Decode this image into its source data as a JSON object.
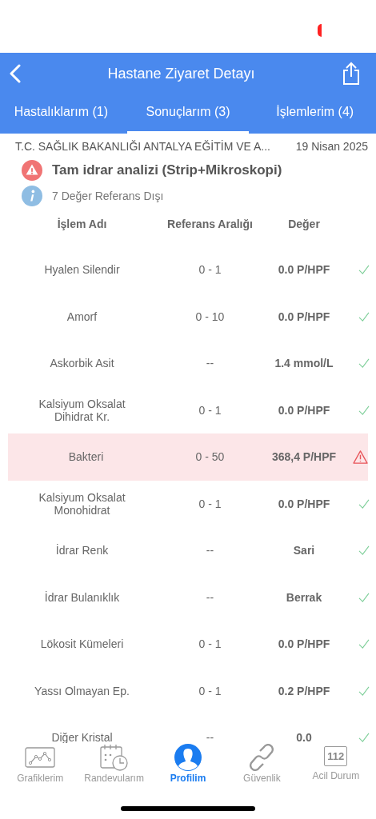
{
  "header": {
    "title": "Hastane Ziyaret Detayı"
  },
  "tabs": [
    {
      "label": "Hastalıklarım (1)",
      "selected": false
    },
    {
      "label": "Sonuçlarım (3)",
      "selected": true
    },
    {
      "label": "İşlemlerim (4)",
      "selected": false
    }
  ],
  "visit": {
    "hospital": "T.C. SAĞLIK BAKANLIĞI ANTALYA EĞİTİM VE A...",
    "date": "19 Nisan 2025"
  },
  "test": {
    "title": "Tam idrar analizi (Strip+Mikroskopi)",
    "out_of_range": "7 Değer Referans Dışı"
  },
  "table": {
    "columns": [
      "İşlem Adı",
      "Referans Aralığı",
      "Değer"
    ],
    "rows": [
      {
        "name": "Hyalen Silendir",
        "range": "0 - 1",
        "value": "0.0 P/HPF",
        "out_of_range": false
      },
      {
        "name": "Amorf",
        "range": "0 - 10",
        "value": "0.0 P/HPF",
        "out_of_range": false
      },
      {
        "name": "Askorbik Asit",
        "range": "--",
        "value": "1.4 mmol/L",
        "out_of_range": false
      },
      {
        "name": "Kalsiyum Oksalat Dihidrat Kr.",
        "range": "0 - 1",
        "value": "0.0 P/HPF",
        "out_of_range": false
      },
      {
        "name": "Bakteri",
        "range": "0 - 50",
        "value": "368,4 P/HPF",
        "out_of_range": true
      },
      {
        "name": "Kalsiyum Oksalat Monohidrat",
        "range": "0 - 1",
        "value": "0.0 P/HPF",
        "out_of_range": false
      },
      {
        "name": "İdrar Renk",
        "range": "--",
        "value": "Sari",
        "out_of_range": false
      },
      {
        "name": "İdrar Bulanıklık",
        "range": "--",
        "value": "Berrak",
        "out_of_range": false
      },
      {
        "name": "Lökosit Kümeleri",
        "range": "0 - 1",
        "value": "0.0 P/HPF",
        "out_of_range": false
      },
      {
        "name": "Yassı Olmayan Ep.",
        "range": "0 - 1",
        "value": "0.2 P/HPF",
        "out_of_range": false
      },
      {
        "name": "Diğer Kristal",
        "range": "--",
        "value": "0.0",
        "out_of_range": false
      }
    ]
  },
  "tab_bar": [
    {
      "kind": "chart",
      "label": "Grafiklerim",
      "selected": false
    },
    {
      "kind": "calendar",
      "label": "Randevularım",
      "selected": false
    },
    {
      "kind": "profile",
      "label": "Profilim",
      "selected": true
    },
    {
      "kind": "link",
      "label": "Güvenlik",
      "selected": false
    },
    {
      "kind": "emergency",
      "label": "Acil Durum",
      "badge": "112",
      "selected": false
    }
  ]
}
